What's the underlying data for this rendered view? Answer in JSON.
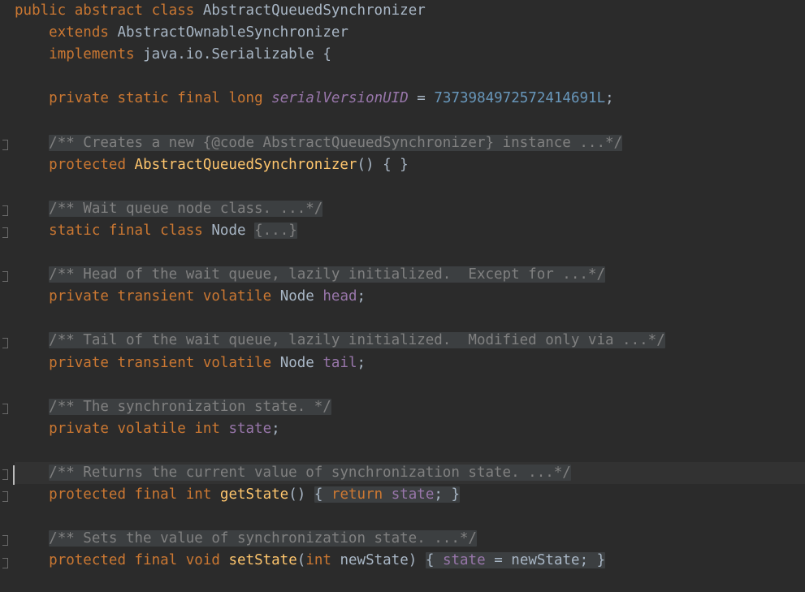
{
  "editor": {
    "file_language": "Java",
    "theme_name": "Darcula",
    "colors": {
      "background": "#2b2b2b",
      "current_line": "#323232",
      "fold_background": "#3c3f41",
      "fold_text": "#808080",
      "keyword": "#cc7832",
      "identifier": "#a9b7c6",
      "field": "#9876aa",
      "method": "#ffc66d",
      "number": "#6897bb",
      "caret": "#bbbbbb",
      "gutter_marker": "#6a6a6a"
    },
    "caret": {
      "line_index": 16,
      "column": 0
    },
    "current_line_index": 16
  },
  "code": {
    "lines": [
      {
        "index": 0,
        "fold_marker": false,
        "tokens": [
          {
            "t": "public",
            "c": "kw"
          },
          {
            "t": " ",
            "c": "punc"
          },
          {
            "t": "abstract",
            "c": "kw"
          },
          {
            "t": " ",
            "c": "punc"
          },
          {
            "t": "class",
            "c": "kw"
          },
          {
            "t": " ",
            "c": "punc"
          },
          {
            "t": "AbstractQueuedSynchronizer",
            "c": "cls"
          }
        ]
      },
      {
        "index": 1,
        "fold_marker": false,
        "tokens": [
          {
            "t": "    ",
            "c": "punc"
          },
          {
            "t": "extends",
            "c": "kw"
          },
          {
            "t": " ",
            "c": "punc"
          },
          {
            "t": "AbstractOwnableSynchronizer",
            "c": "cls"
          }
        ]
      },
      {
        "index": 2,
        "fold_marker": false,
        "tokens": [
          {
            "t": "    ",
            "c": "punc"
          },
          {
            "t": "implements",
            "c": "kw"
          },
          {
            "t": " ",
            "c": "punc"
          },
          {
            "t": "java.io.Serializable",
            "c": "cls"
          },
          {
            "t": " {",
            "c": "punc"
          }
        ]
      },
      {
        "index": 3,
        "fold_marker": false,
        "tokens": []
      },
      {
        "index": 4,
        "fold_marker": false,
        "tokens": [
          {
            "t": "    ",
            "c": "punc"
          },
          {
            "t": "private",
            "c": "kw"
          },
          {
            "t": " ",
            "c": "punc"
          },
          {
            "t": "static",
            "c": "kw"
          },
          {
            "t": " ",
            "c": "punc"
          },
          {
            "t": "final",
            "c": "kw"
          },
          {
            "t": " ",
            "c": "punc"
          },
          {
            "t": "long",
            "c": "kw"
          },
          {
            "t": " ",
            "c": "punc"
          },
          {
            "t": "serialVersionUID",
            "c": "sfld"
          },
          {
            "t": " ",
            "c": "punc"
          },
          {
            "t": "=",
            "c": "op"
          },
          {
            "t": " ",
            "c": "punc"
          },
          {
            "t": "7373984972572414691L",
            "c": "num"
          },
          {
            "t": ";",
            "c": "punc"
          }
        ]
      },
      {
        "index": 5,
        "fold_marker": false,
        "tokens": []
      },
      {
        "index": 6,
        "fold_marker": true,
        "tokens": [
          {
            "t": "    ",
            "c": "punc"
          },
          {
            "t": "/** Creates a new {@code AbstractQueuedSynchronizer} instance ...*/",
            "c": "fold"
          }
        ]
      },
      {
        "index": 7,
        "fold_marker": false,
        "tokens": [
          {
            "t": "    ",
            "c": "punc"
          },
          {
            "t": "protected",
            "c": "kw"
          },
          {
            "t": " ",
            "c": "punc"
          },
          {
            "t": "AbstractQueuedSynchronizer",
            "c": "mth"
          },
          {
            "t": "()",
            "c": "paren"
          },
          {
            "t": " ",
            "c": "punc"
          },
          {
            "t": "{ }",
            "c": "plain-brace"
          }
        ]
      },
      {
        "index": 8,
        "fold_marker": false,
        "tokens": []
      },
      {
        "index": 9,
        "fold_marker": true,
        "tokens": [
          {
            "t": "    ",
            "c": "punc"
          },
          {
            "t": "/** Wait queue node class. ...*/",
            "c": "fold"
          }
        ]
      },
      {
        "index": 10,
        "fold_marker": true,
        "tokens": [
          {
            "t": "    ",
            "c": "punc"
          },
          {
            "t": "static",
            "c": "kw"
          },
          {
            "t": " ",
            "c": "punc"
          },
          {
            "t": "final",
            "c": "kw"
          },
          {
            "t": " ",
            "c": "punc"
          },
          {
            "t": "class",
            "c": "kw"
          },
          {
            "t": " ",
            "c": "punc"
          },
          {
            "t": "Node",
            "c": "cls"
          },
          {
            "t": " ",
            "c": "punc"
          },
          {
            "t": "{...}",
            "c": "fold"
          }
        ]
      },
      {
        "index": 11,
        "fold_marker": false,
        "tokens": []
      },
      {
        "index": 12,
        "fold_marker": true,
        "tokens": [
          {
            "t": "    ",
            "c": "punc"
          },
          {
            "t": "/** Head of the wait queue, lazily initialized.  Except for ...*/",
            "c": "fold"
          }
        ]
      },
      {
        "index": 13,
        "fold_marker": false,
        "tokens": [
          {
            "t": "    ",
            "c": "punc"
          },
          {
            "t": "private",
            "c": "kw"
          },
          {
            "t": " ",
            "c": "punc"
          },
          {
            "t": "transient",
            "c": "kw"
          },
          {
            "t": " ",
            "c": "punc"
          },
          {
            "t": "volatile",
            "c": "kw"
          },
          {
            "t": " ",
            "c": "punc"
          },
          {
            "t": "Node",
            "c": "cls"
          },
          {
            "t": " ",
            "c": "punc"
          },
          {
            "t": "head",
            "c": "fld"
          },
          {
            "t": ";",
            "c": "punc"
          }
        ]
      },
      {
        "index": 14,
        "fold_marker": false,
        "tokens": []
      },
      {
        "index": 15,
        "fold_marker": true,
        "tokens": [
          {
            "t": "    ",
            "c": "punc"
          },
          {
            "t": "/** Tail of the wait queue, lazily initialized.  Modified only via ...*/",
            "c": "fold"
          }
        ]
      },
      {
        "index": 16,
        "fold_marker": false,
        "tokens": [
          {
            "t": "    ",
            "c": "punc"
          },
          {
            "t": "private",
            "c": "kw"
          },
          {
            "t": " ",
            "c": "punc"
          },
          {
            "t": "transient",
            "c": "kw"
          },
          {
            "t": " ",
            "c": "punc"
          },
          {
            "t": "volatile",
            "c": "kw"
          },
          {
            "t": " ",
            "c": "punc"
          },
          {
            "t": "Node",
            "c": "cls"
          },
          {
            "t": " ",
            "c": "punc"
          },
          {
            "t": "tail",
            "c": "fld"
          },
          {
            "t": ";",
            "c": "punc"
          }
        ]
      },
      {
        "index": 17,
        "fold_marker": false,
        "tokens": []
      },
      {
        "index": 18,
        "fold_marker": true,
        "tokens": [
          {
            "t": "    ",
            "c": "punc"
          },
          {
            "t": "/** The synchronization state. */",
            "c": "fold"
          }
        ]
      },
      {
        "index": 19,
        "fold_marker": false,
        "tokens": [
          {
            "t": "    ",
            "c": "punc"
          },
          {
            "t": "private",
            "c": "kw"
          },
          {
            "t": " ",
            "c": "punc"
          },
          {
            "t": "volatile",
            "c": "kw"
          },
          {
            "t": " ",
            "c": "punc"
          },
          {
            "t": "int",
            "c": "kw"
          },
          {
            "t": " ",
            "c": "punc"
          },
          {
            "t": "state",
            "c": "fld"
          },
          {
            "t": ";",
            "c": "punc"
          }
        ]
      },
      {
        "index": 20,
        "fold_marker": false,
        "tokens": []
      },
      {
        "index": 21,
        "fold_marker": true,
        "current": true,
        "tokens": [
          {
            "t": "    ",
            "c": "punc"
          },
          {
            "t": "/** Returns the current value of synchronization state. ...*/",
            "c": "fold"
          }
        ]
      },
      {
        "index": 22,
        "fold_marker": true,
        "tokens": [
          {
            "t": "    ",
            "c": "punc"
          },
          {
            "t": "protected",
            "c": "kw"
          },
          {
            "t": " ",
            "c": "punc"
          },
          {
            "t": "final",
            "c": "kw"
          },
          {
            "t": " ",
            "c": "punc"
          },
          {
            "t": "int",
            "c": "kw"
          },
          {
            "t": " ",
            "c": "punc"
          },
          {
            "t": "getState",
            "c": "mth"
          },
          {
            "t": "()",
            "c": "paren"
          },
          {
            "t": " ",
            "c": "punc"
          },
          {
            "t": "{",
            "c": "fold-open"
          },
          {
            "t": " ",
            "c": "punc"
          },
          {
            "t": "return",
            "c": "kw"
          },
          {
            "t": " ",
            "c": "punc"
          },
          {
            "t": "state",
            "c": "fld"
          },
          {
            "t": ";",
            "c": "punc"
          },
          {
            "t": " ",
            "c": "punc"
          },
          {
            "t": "}",
            "c": "fold-close"
          }
        ]
      },
      {
        "index": 23,
        "fold_marker": false,
        "tokens": []
      },
      {
        "index": 24,
        "fold_marker": true,
        "tokens": [
          {
            "t": "    ",
            "c": "punc"
          },
          {
            "t": "/** Sets the value of synchronization state. ...*/",
            "c": "fold"
          }
        ]
      },
      {
        "index": 25,
        "fold_marker": true,
        "tokens": [
          {
            "t": "    ",
            "c": "punc"
          },
          {
            "t": "protected",
            "c": "kw"
          },
          {
            "t": " ",
            "c": "punc"
          },
          {
            "t": "final",
            "c": "kw"
          },
          {
            "t": " ",
            "c": "punc"
          },
          {
            "t": "void",
            "c": "kw"
          },
          {
            "t": " ",
            "c": "punc"
          },
          {
            "t": "setState",
            "c": "mth"
          },
          {
            "t": "(",
            "c": "paren"
          },
          {
            "t": "int",
            "c": "kw"
          },
          {
            "t": " ",
            "c": "punc"
          },
          {
            "t": "newState",
            "c": "ident"
          },
          {
            "t": ")",
            "c": "paren"
          },
          {
            "t": " ",
            "c": "punc"
          },
          {
            "t": "{",
            "c": "fold-open"
          },
          {
            "t": " ",
            "c": "punc"
          },
          {
            "t": "state",
            "c": "fld"
          },
          {
            "t": " ",
            "c": "punc"
          },
          {
            "t": "=",
            "c": "op"
          },
          {
            "t": " ",
            "c": "punc"
          },
          {
            "t": "newState",
            "c": "ident"
          },
          {
            "t": ";",
            "c": "punc"
          },
          {
            "t": " ",
            "c": "punc"
          },
          {
            "t": "}",
            "c": "fold-close"
          }
        ]
      }
    ]
  }
}
